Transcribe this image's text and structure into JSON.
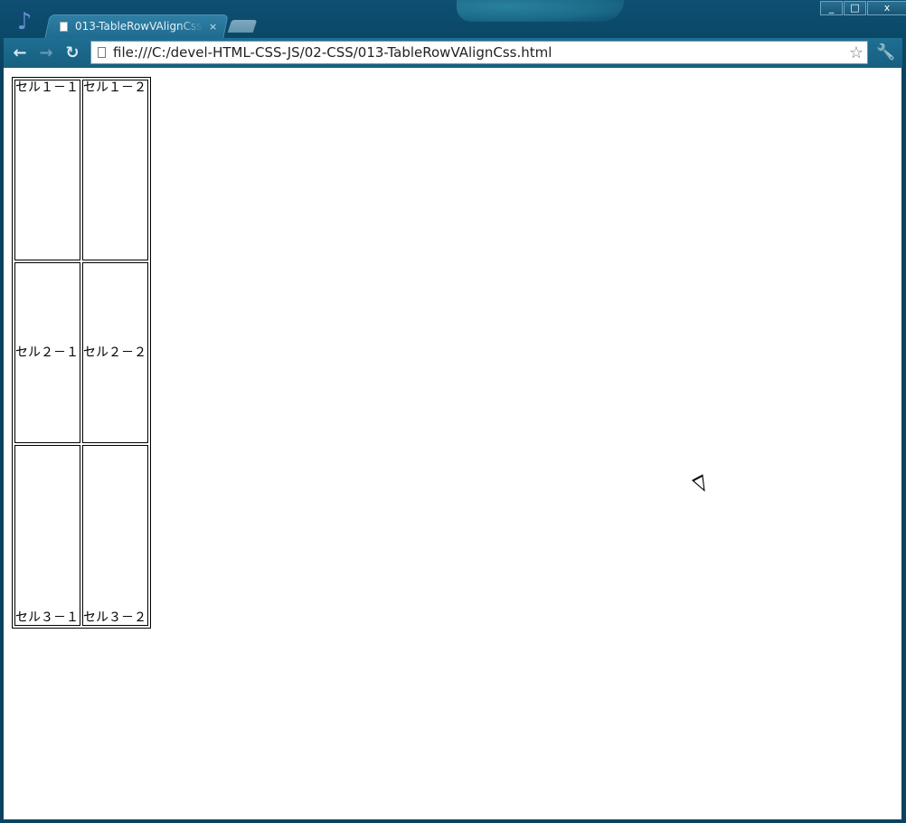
{
  "browser": {
    "tab_title": "013-TableRowVAlignCss.html",
    "tab_close": "×",
    "url": "file:///C:/devel-HTML-CSS-JS/02-CSS/013-TableRowVAlignCss.html",
    "window_controls": {
      "minimize": "_",
      "maximize": "□",
      "close": "x"
    },
    "icons": {
      "app": "music-note-icon",
      "back": "back-arrow-icon",
      "forward": "forward-arrow-icon",
      "reload": "reload-icon",
      "bookmark": "star-icon",
      "menu": "wrench-icon"
    },
    "colors": {
      "frame": "#0b4868",
      "toolbar": "#1e6f93"
    }
  },
  "page": {
    "table": {
      "rows": [
        {
          "valign": "top",
          "cells": [
            "セル１－１",
            "セル１－２"
          ]
        },
        {
          "valign": "middle",
          "cells": [
            "セル２－１",
            "セル２－２"
          ]
        },
        {
          "valign": "bottom",
          "cells": [
            "セル３－１",
            "セル３－２"
          ]
        }
      ]
    }
  }
}
